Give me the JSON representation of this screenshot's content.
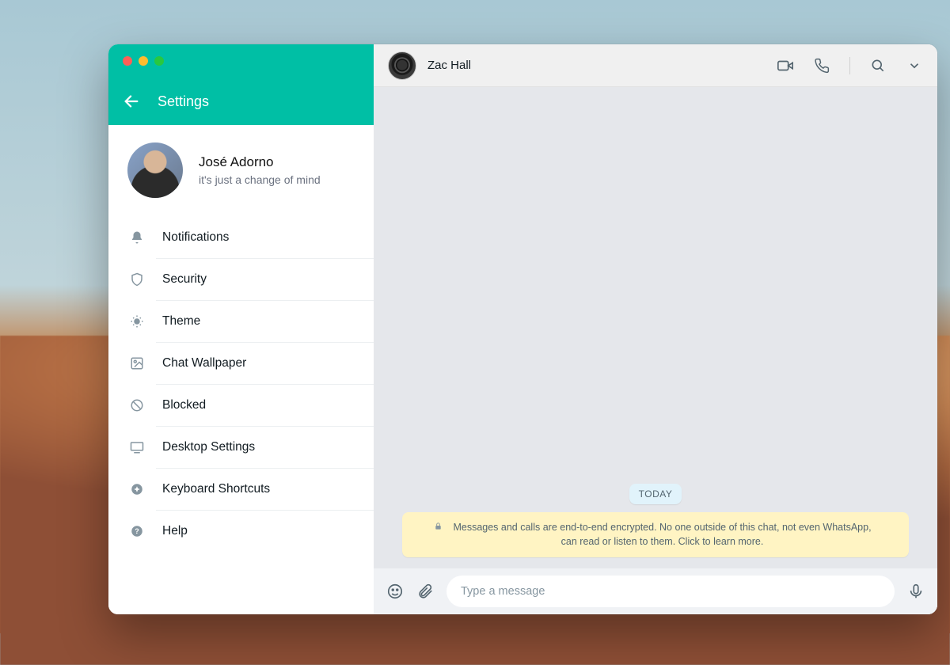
{
  "sidebar": {
    "title": "Settings",
    "profile": {
      "name": "José Adorno",
      "status": "it's just a change of mind"
    },
    "items": [
      {
        "id": "notifications",
        "label": "Notifications",
        "icon": "bell-icon"
      },
      {
        "id": "security",
        "label": "Security",
        "icon": "shield-icon"
      },
      {
        "id": "theme",
        "label": "Theme",
        "icon": "theme-icon"
      },
      {
        "id": "wallpaper",
        "label": "Chat Wallpaper",
        "icon": "wallpaper-icon"
      },
      {
        "id": "blocked",
        "label": "Blocked",
        "icon": "blocked-icon"
      },
      {
        "id": "desktop",
        "label": "Desktop Settings",
        "icon": "desktop-icon"
      },
      {
        "id": "shortcuts",
        "label": "Keyboard Shortcuts",
        "icon": "keyboard-icon"
      },
      {
        "id": "help",
        "label": "Help",
        "icon": "help-icon"
      }
    ]
  },
  "chat": {
    "contact_name": "Zac Hall",
    "date_pill": "TODAY",
    "encryption_notice": "Messages and calls are end-to-end encrypted. No one outside of this chat, not even WhatsApp, can read or listen to them. Click to learn more.",
    "composer_placeholder": "Type a message"
  },
  "colors": {
    "accent": "#00bfa5",
    "panel": "#f0f2f5",
    "notice": "#fff4c3"
  }
}
